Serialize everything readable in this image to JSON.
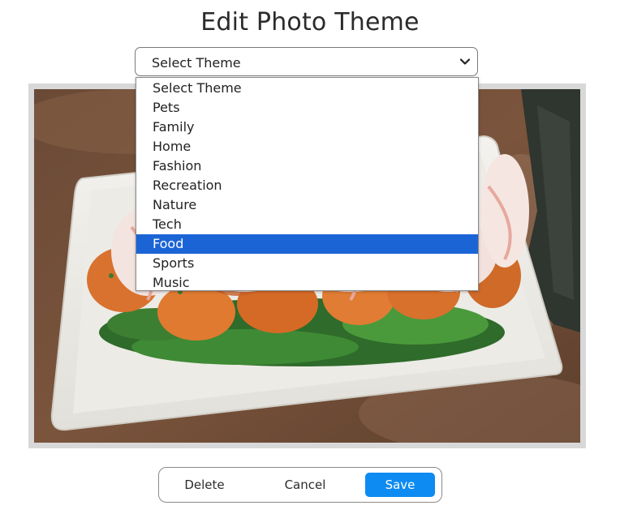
{
  "page": {
    "title": "Edit Photo Theme"
  },
  "theme_select": {
    "selected_label": "Select Theme",
    "options": [
      "Select Theme",
      "Pets",
      "Family",
      "Home",
      "Fashion",
      "Recreation",
      "Nature",
      "Tech",
      "Food",
      "Sports",
      "Music"
    ],
    "highlighted_option": "Food"
  },
  "photo": {
    "subject": "plate of fried shrimp with crab salad over greens",
    "icon": "photo-image"
  },
  "actions": {
    "delete_label": "Delete",
    "cancel_label": "Cancel",
    "save_label": "Save"
  },
  "colors": {
    "highlight": "#1b64d6",
    "save_button": "#0d8bf2",
    "title_text": "#2b2b2b"
  }
}
